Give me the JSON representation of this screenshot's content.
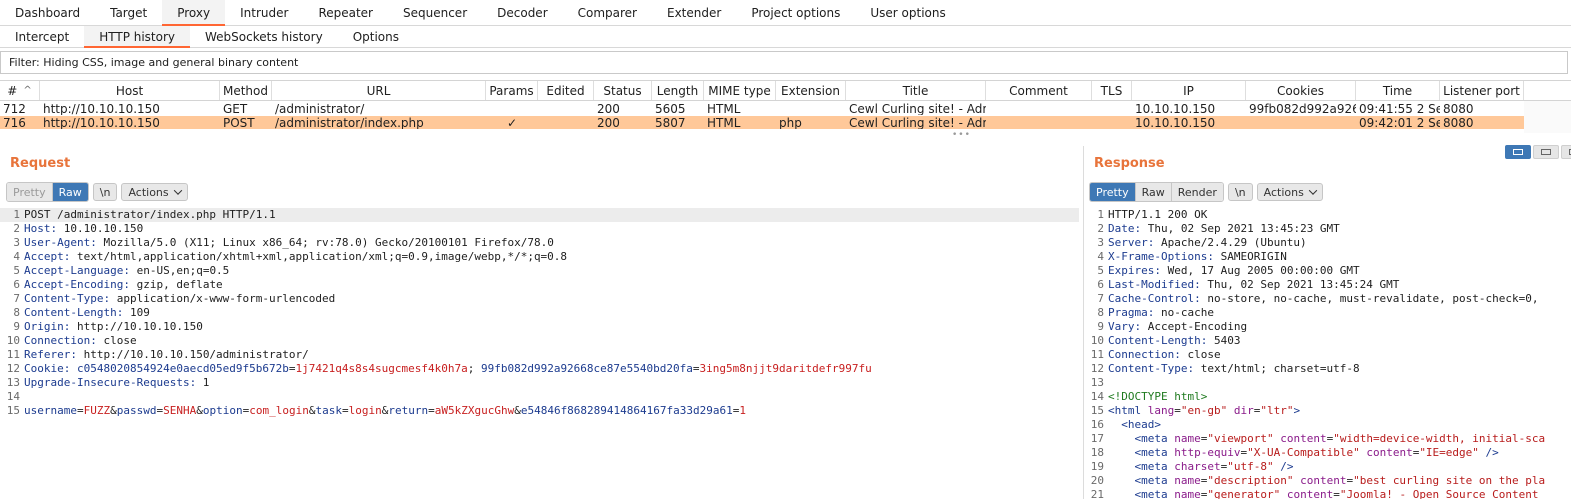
{
  "main_tabs": [
    "Dashboard",
    "Target",
    "Proxy",
    "Intruder",
    "Repeater",
    "Sequencer",
    "Decoder",
    "Comparer",
    "Extender",
    "Project options",
    "User options"
  ],
  "main_tab_active": "Proxy",
  "sub_tabs": [
    "Intercept",
    "HTTP history",
    "WebSockets history",
    "Options"
  ],
  "sub_tab_active": "HTTP history",
  "filter_text": "Filter: Hiding CSS, image and general binary content",
  "table": {
    "columns": [
      "#",
      "Host",
      "Method",
      "URL",
      "Params",
      "Edited",
      "Status",
      "Length",
      "MIME type",
      "Extension",
      "Title",
      "Comment",
      "TLS",
      "IP",
      "Cookies",
      "Time",
      "Listener port"
    ],
    "sort_indicator": "^",
    "rows": [
      {
        "num": "712",
        "host": "http://10.10.10.150",
        "method": "GET",
        "url": "/administrator/",
        "params": "",
        "edited": "",
        "status": "200",
        "length": "5605",
        "mime": "HTML",
        "ext": "",
        "title": "Cewl Curling site! - Admi...",
        "comment": "",
        "tls": "",
        "ip": "10.10.10.150",
        "cookies": "99fb082d992a926...",
        "time": "09:41:55 2 Se...",
        "port": "8080"
      },
      {
        "num": "716",
        "host": "http://10.10.10.150",
        "method": "POST",
        "url": "/administrator/index.php",
        "params": "✓",
        "edited": "",
        "status": "200",
        "length": "5807",
        "mime": "HTML",
        "ext": "php",
        "title": "Cewl Curling site! - Admi...",
        "comment": "",
        "tls": "",
        "ip": "10.10.10.150",
        "cookies": "",
        "time": "09:42:01 2 Se...",
        "port": "8080"
      }
    ],
    "selected_row": "716"
  },
  "request": {
    "title": "Request",
    "view_buttons": [
      "Pretty",
      "Raw"
    ],
    "newline_button": "\\n",
    "actions_label": "Actions",
    "lines": [
      {
        "n": "1",
        "k": "POST /administrator/index.php HTTP/1.1",
        "v": ""
      },
      {
        "n": "2",
        "k": "Host:",
        "v": " 10.10.10.150"
      },
      {
        "n": "3",
        "k": "User-Agent:",
        "v": " Mozilla/5.0 (X11; Linux x86_64; rv:78.0) Gecko/20100101 Firefox/78.0"
      },
      {
        "n": "4",
        "k": "Accept:",
        "v": " text/html,application/xhtml+xml,application/xml;q=0.9,image/webp,*/*;q=0.8"
      },
      {
        "n": "5",
        "k": "Accept-Language:",
        "v": " en-US,en;q=0.5"
      },
      {
        "n": "6",
        "k": "Accept-Encoding:",
        "v": " gzip, deflate"
      },
      {
        "n": "7",
        "k": "Content-Type:",
        "v": " application/x-www-form-urlencoded"
      },
      {
        "n": "8",
        "k": "Content-Length:",
        "v": " 109"
      },
      {
        "n": "9",
        "k": "Origin:",
        "v": " http://10.10.10.150"
      },
      {
        "n": "10",
        "k": "Connection:",
        "v": " close"
      },
      {
        "n": "11",
        "k": "Referer:",
        "v": " http://10.10.10.150/administrator/"
      },
      {
        "n": "13",
        "k": "Upgrade-Insecure-Requests:",
        "v": " 1"
      },
      {
        "n": "14",
        "k": "",
        "v": ""
      }
    ],
    "cookie_line": {
      "n": "12",
      "k": "Cookie:",
      "c1_name": "c0548020854924e0aecd05ed9f5b672b",
      "c1_val": "1j7421q4s8s4sugcmesf4k0h7a",
      "c2_name": "99fb082d992a92668ce87e5540bd20fa",
      "c2_val": "3ing5m8njjt9daritdefr997fu"
    },
    "body_line": {
      "n": "15",
      "p1k": "username",
      "p1v": "FUZZ",
      "p2k": "passwd",
      "p2v": "SENHA",
      "p3k": "option",
      "p3v": "com_login",
      "p4k": "task",
      "p4v": "login",
      "p5k": "return",
      "p5v": "aW5kZXgucGhw",
      "p6k": "e54846f868289414864167fa33d29a61",
      "p6v": "1"
    }
  },
  "response": {
    "title": "Response",
    "view_buttons": [
      "Pretty",
      "Raw",
      "Render"
    ],
    "newline_button": "\\n",
    "actions_label": "Actions",
    "header_lines": [
      {
        "n": "1",
        "k": "HTTP/1.1 200 OK",
        "v": ""
      },
      {
        "n": "2",
        "k": "Date:",
        "v": " Thu, 02 Sep 2021 13:45:23 GMT"
      },
      {
        "n": "3",
        "k": "Server:",
        "v": " Apache/2.4.29 (Ubuntu)"
      },
      {
        "n": "4",
        "k": "X-Frame-Options:",
        "v": " SAMEORIGIN"
      },
      {
        "n": "5",
        "k": "Expires:",
        "v": " Wed, 17 Aug 2005 00:00:00 GMT"
      },
      {
        "n": "6",
        "k": "Last-Modified:",
        "v": " Thu, 02 Sep 2021 13:45:24 GMT"
      },
      {
        "n": "7",
        "k": "Cache-Control:",
        "v": " no-store, no-cache, must-revalidate, post-check=0,"
      },
      {
        "n": "8",
        "k": "Pragma:",
        "v": " no-cache"
      },
      {
        "n": "9",
        "k": "Vary:",
        "v": " Accept-Encoding"
      },
      {
        "n": "10",
        "k": "Content-Length:",
        "v": " 5403"
      },
      {
        "n": "11",
        "k": "Connection:",
        "v": " close"
      },
      {
        "n": "12",
        "k": "Content-Type:",
        "v": " text/html; charset=utf-8"
      },
      {
        "n": "13",
        "k": "",
        "v": ""
      }
    ],
    "html_lines": [
      {
        "n": "14",
        "indent": "",
        "doctype": "<!DOCTYPE html>"
      },
      {
        "n": "15",
        "indent": "",
        "open": "<html",
        "attrs": [
          [
            "lang",
            "\"en-gb\""
          ],
          [
            "dir",
            "\"ltr\""
          ]
        ],
        "close": ">"
      },
      {
        "n": "16",
        "indent": "  ",
        "open": "<head",
        "attrs": [],
        "close": ">"
      },
      {
        "n": "17",
        "indent": "    ",
        "open": "<meta",
        "attrs": [
          [
            "name",
            "\"viewport\""
          ],
          [
            "content",
            "\"width=device-width, initial-sca"
          ]
        ],
        "close": ""
      },
      {
        "n": "18",
        "indent": "    ",
        "open": "<meta",
        "attrs": [
          [
            "http-equiv",
            "\"X-UA-Compatible\""
          ],
          [
            "content",
            "\"IE=edge\""
          ]
        ],
        "close": " />"
      },
      {
        "n": "19",
        "indent": "    ",
        "open": "<meta",
        "attrs": [
          [
            "charset",
            "\"utf-8\""
          ]
        ],
        "close": " />"
      },
      {
        "n": "20",
        "indent": "    ",
        "open": "<meta",
        "attrs": [
          [
            "name",
            "\"description\""
          ],
          [
            "content",
            "\"best curling site on the pla"
          ]
        ],
        "close": ""
      },
      {
        "n": "21",
        "indent": "    ",
        "open": "<meta",
        "attrs": [
          [
            "name",
            "\"generator\""
          ],
          [
            "content",
            "\"Joomla! - Open Source Content"
          ]
        ],
        "close": ""
      }
    ]
  }
}
